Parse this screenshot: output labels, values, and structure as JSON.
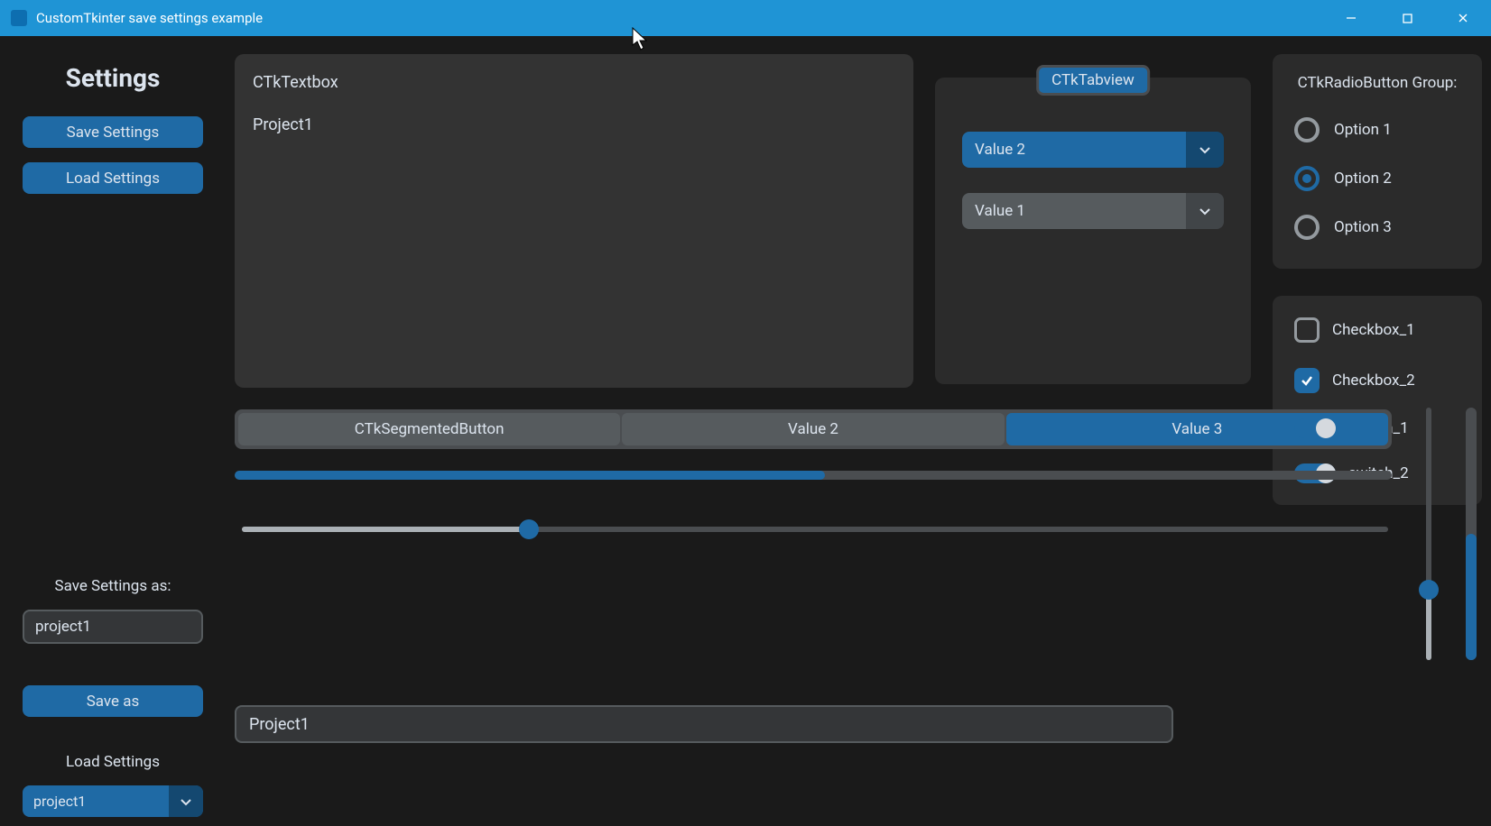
{
  "window": {
    "title": "CustomTkinter save settings example"
  },
  "sidebar": {
    "heading": "Settings",
    "save_btn": "Save Settings",
    "load_btn": "Load Settings",
    "save_as_label": "Save Settings as:",
    "save_as_value": "project1",
    "save_as_btn": "Save as",
    "load_dropdown_label": "Load Settings",
    "load_dropdown_value": "project1"
  },
  "textbox": {
    "line1": "CTkTextbox",
    "line2": "Project1"
  },
  "tabview": {
    "tab_label": "CTkTabview",
    "option1": "Value 2",
    "option2": "Value 1"
  },
  "segmented": {
    "items": [
      "CTkSegmentedButton",
      "Value 2",
      "Value 3"
    ],
    "selected_index": 2
  },
  "progress": {
    "value_pct": 51
  },
  "h_slider": {
    "value_pct": 25
  },
  "v_slider": {
    "value_pct": 28
  },
  "v_progress": {
    "value_pct": 50
  },
  "entry2": {
    "value": "Project1"
  },
  "radio": {
    "title": "CTkRadioButton Group:",
    "options": [
      "Option 1",
      "Option 2",
      "Option 3"
    ],
    "selected_index": 1
  },
  "checkboxes": [
    {
      "label": "Checkbox_1",
      "checked": false
    },
    {
      "label": "Checkbox_2",
      "checked": true
    }
  ],
  "switches": [
    {
      "label": "switch_1",
      "on": true
    },
    {
      "label": "switch_2",
      "on": true
    }
  ]
}
